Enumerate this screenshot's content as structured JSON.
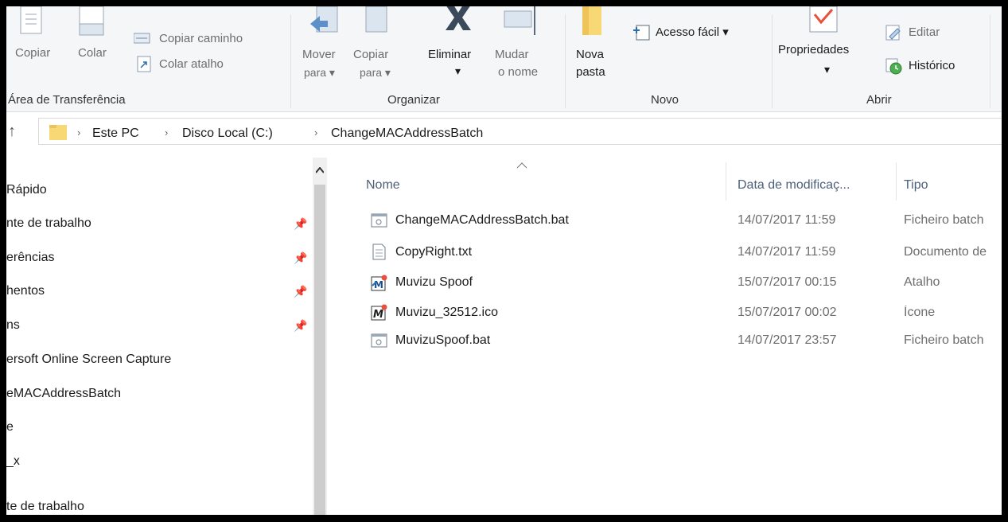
{
  "ribbon": {
    "clipboard": {
      "copy": "Copiar",
      "paste": "Colar",
      "copy_path": "Copiar caminho",
      "paste_shortcut": "Colar atalho",
      "group_label": "Área de Transferência"
    },
    "organize": {
      "move_to_1": "Mover",
      "move_to_2": "para",
      "copy_to_1": "Copiar",
      "copy_to_2": "para",
      "delete": "Eliminar",
      "rename_1": "Mudar",
      "rename_2": "o nome",
      "group_label": "Organizar"
    },
    "new": {
      "new_folder_1": "Nova",
      "new_folder_2": "pasta",
      "easy_access": "Acesso fácil",
      "group_label": "Novo"
    },
    "open": {
      "properties": "Propriedades",
      "edit": "Editar",
      "history": "Histórico",
      "group_label": "Abrir"
    },
    "dropdown_glyph": "▾"
  },
  "address": {
    "crumbs": [
      "Este PC",
      "Disco Local (C:)",
      "ChangeMACAddressBatch"
    ],
    "separator": "›"
  },
  "nav": {
    "items": [
      "Rápido",
      "nte de trabalho",
      "erências",
      "hentos",
      "ns",
      "ersoft Online Screen Capture",
      "eMACAddressBatch",
      "e",
      "_x",
      "te de trabalho"
    ],
    "pin_glyph": "📌"
  },
  "files": {
    "columns": {
      "name": "Nome",
      "date": "Data de modificaç...",
      "type": "Tipo"
    },
    "rows": [
      {
        "name": "ChangeMACAddressBatch.bat",
        "date": "14/07/2017 11:59",
        "type": "Ficheiro batch"
      },
      {
        "name": "CopyRight.txt",
        "date": "14/07/2017 11:59",
        "type": "Documento de"
      },
      {
        "name": "Muvizu Spoof",
        "date": "15/07/2017 00:15",
        "type": "Atalho"
      },
      {
        "name": "Muvizu_32512.ico",
        "date": "15/07/2017 00:02",
        "type": "Ícone"
      },
      {
        "name": "MuvizuSpoof.bat",
        "date": "14/07/2017 23:57",
        "type": "Ficheiro batch"
      }
    ]
  },
  "colors": {
    "folder": "#f8d775",
    "accent": "#1979ca",
    "check": "#e8503a"
  }
}
